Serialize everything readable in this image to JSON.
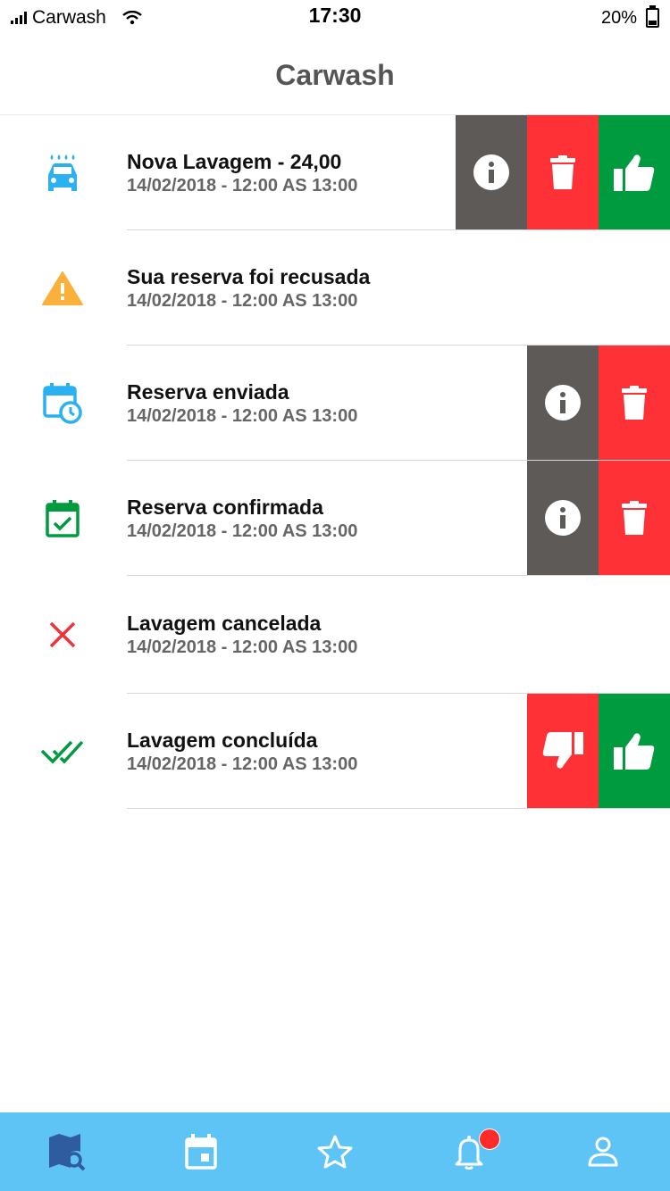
{
  "status_bar": {
    "carrier": "Carwash",
    "time": "17:30",
    "battery": "20%"
  },
  "header": {
    "title": "Carwash"
  },
  "notifications": [
    {
      "title": "Nova Lavagem - 24,00",
      "subtitle": "14/02/2018 - 12:00 AS 13:00",
      "icon": "car-wash-icon",
      "actions": [
        "info",
        "delete",
        "accept"
      ]
    },
    {
      "title": "Sua reserva foi recusada",
      "subtitle": "14/02/2018 - 12:00 AS 13:00",
      "icon": "warning-icon",
      "actions": []
    },
    {
      "title": "Reserva enviada",
      "subtitle": "14/02/2018 - 12:00 AS 13:00",
      "icon": "calendar-clock-icon",
      "actions": [
        "info",
        "delete"
      ]
    },
    {
      "title": "Reserva confirmada",
      "subtitle": "14/02/2018 - 12:00 AS 13:00",
      "icon": "calendar-check-icon",
      "actions": [
        "info",
        "delete"
      ]
    },
    {
      "title": "Lavagem cancelada",
      "subtitle": "14/02/2018 - 12:00 AS 13:00",
      "icon": "close-icon",
      "actions": []
    },
    {
      "title": "Lavagem concluída",
      "subtitle": "14/02/2018 - 12:00 AS 13:00",
      "icon": "double-check-icon",
      "actions": [
        "dislike",
        "like"
      ]
    }
  ],
  "tab_bar": {
    "items": [
      {
        "icon": "map-search-icon",
        "active": true
      },
      {
        "icon": "calendar-icon",
        "active": false
      },
      {
        "icon": "star-icon",
        "active": false
      },
      {
        "icon": "bell-icon",
        "active": false,
        "badge": true
      },
      {
        "icon": "user-icon",
        "active": false
      }
    ]
  },
  "colors": {
    "accent": "#5ec3f5",
    "info": "#5e5a57",
    "delete": "#fd3136",
    "accept": "#009a3f",
    "warning": "#fbb03b",
    "active_tab": "#2e5c9e"
  }
}
